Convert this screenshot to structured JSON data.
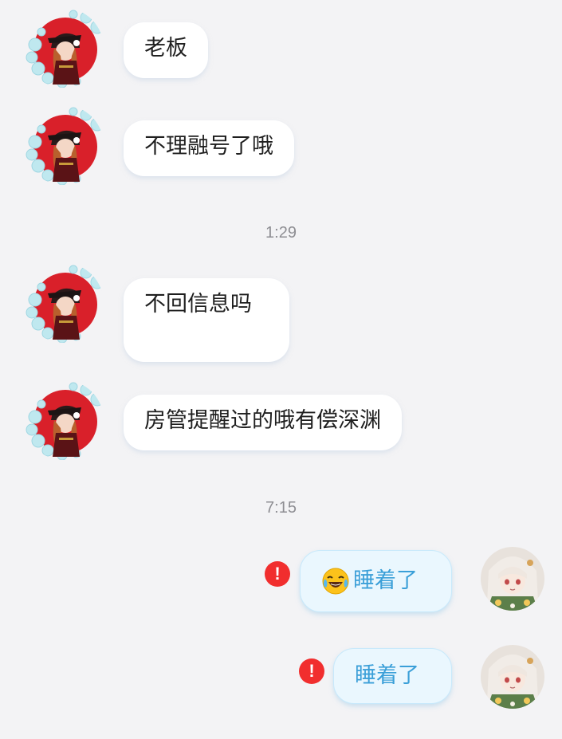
{
  "messages": {
    "m1": {
      "text": "老板"
    },
    "m2": {
      "text": "不理融号了哦"
    },
    "t1": {
      "time": "1:29"
    },
    "m3": {
      "text": "不回信息吗"
    },
    "m4": {
      "text": "房管提醒过的哦有偿深渊"
    },
    "t2": {
      "time": "7:15"
    },
    "m5": {
      "text": "睡着了",
      "emoji": "laughing-tears-emoji",
      "status": "failed"
    },
    "m6": {
      "text": "睡着了",
      "status": "failed"
    }
  },
  "icons": {
    "error": "exclamation-icon",
    "sender_avatar": "avatar-red-circle-girl",
    "self_avatar": "avatar-white-hair-girl"
  },
  "colors": {
    "background": "#f3f3f5",
    "incoming_bubble": "#ffffff",
    "outgoing_bubble": "#eaf7fe",
    "outgoing_text": "#3a9fd8",
    "error_red": "#f12e2e",
    "timestamp": "#8d8d92"
  }
}
